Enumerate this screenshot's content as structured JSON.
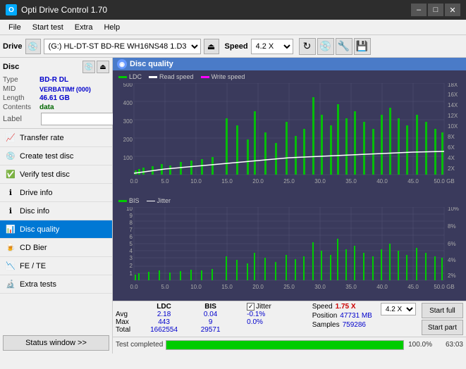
{
  "titleBar": {
    "title": "Opti Drive Control 1.70",
    "minimizeLabel": "–",
    "maximizeLabel": "□",
    "closeLabel": "✕"
  },
  "menuBar": {
    "items": [
      "File",
      "Start test",
      "Extra",
      "Help"
    ]
  },
  "driveBar": {
    "driveLabel": "Drive",
    "driveValue": "(G:)  HL-DT-ST BD-RE  WH16NS48 1.D3",
    "speedLabel": "Speed",
    "speedValue": "4.2 X"
  },
  "discSection": {
    "title": "Disc",
    "typeLabel": "Type",
    "typeValue": "BD-R DL",
    "midLabel": "MID",
    "midValue": "VERBATIMf (000)",
    "lengthLabel": "Length",
    "lengthValue": "46.61 GB",
    "contentsLabel": "Contents",
    "contentsValue": "data",
    "labelLabel": "Label"
  },
  "navItems": [
    {
      "id": "transfer-rate",
      "label": "Transfer rate",
      "active": false
    },
    {
      "id": "create-test-disc",
      "label": "Create test disc",
      "active": false
    },
    {
      "id": "verify-test-disc",
      "label": "Verify test disc",
      "active": false
    },
    {
      "id": "drive-info",
      "label": "Drive info",
      "active": false
    },
    {
      "id": "disc-info",
      "label": "Disc info",
      "active": false
    },
    {
      "id": "disc-quality",
      "label": "Disc quality",
      "active": true
    },
    {
      "id": "cd-bier",
      "label": "CD Bier",
      "active": false
    },
    {
      "id": "fe-te",
      "label": "FE / TE",
      "active": false
    },
    {
      "id": "extra-tests",
      "label": "Extra tests",
      "active": false
    }
  ],
  "statusBtn": "Status window >>",
  "chartPanel": {
    "title": "Disc quality",
    "legend1": {
      "ldc": "LDC",
      "readSpeed": "Read speed",
      "writeSpeed": "Write speed"
    },
    "legend2": {
      "bis": "BIS",
      "jitter": "Jitter"
    },
    "xMax": "50.0 GB",
    "chart1": {
      "yMax": 500,
      "yTicks": [
        100,
        200,
        300,
        400,
        500
      ],
      "yRightTicks": [
        "2X",
        "4X",
        "6X",
        "8X",
        "10X",
        "12X",
        "14X",
        "16X",
        "18X"
      ]
    },
    "chart2": {
      "yMax": 10,
      "yTicks": [
        1,
        2,
        3,
        4,
        5,
        6,
        7,
        8,
        9,
        10
      ],
      "yRightTicks": [
        "2%",
        "4%",
        "6%",
        "8%",
        "10%"
      ]
    }
  },
  "statsBar": {
    "headers": [
      "",
      "LDC",
      "BIS",
      "",
      "Jitter",
      "Speed",
      ""
    ],
    "avg": {
      "label": "Avg",
      "ldc": "2.18",
      "bis": "0.04",
      "jitter": "-0.1%",
      "speed": "1.75 X"
    },
    "max": {
      "label": "Max",
      "ldc": "443",
      "bis": "9",
      "jitter": "0.0%",
      "speedLabel": "Position",
      "position": "47731 MB"
    },
    "total": {
      "label": "Total",
      "ldc": "1662554",
      "bis": "29571",
      "jitter": "",
      "speedLabel": "Samples",
      "samples": "759286"
    },
    "speedSelectValue": "4.2 X",
    "startFullLabel": "Start full",
    "startPartLabel": "Start part"
  },
  "progressBar": {
    "statusText": "Test completed",
    "percent": "100.0%",
    "pages": "63:03"
  }
}
